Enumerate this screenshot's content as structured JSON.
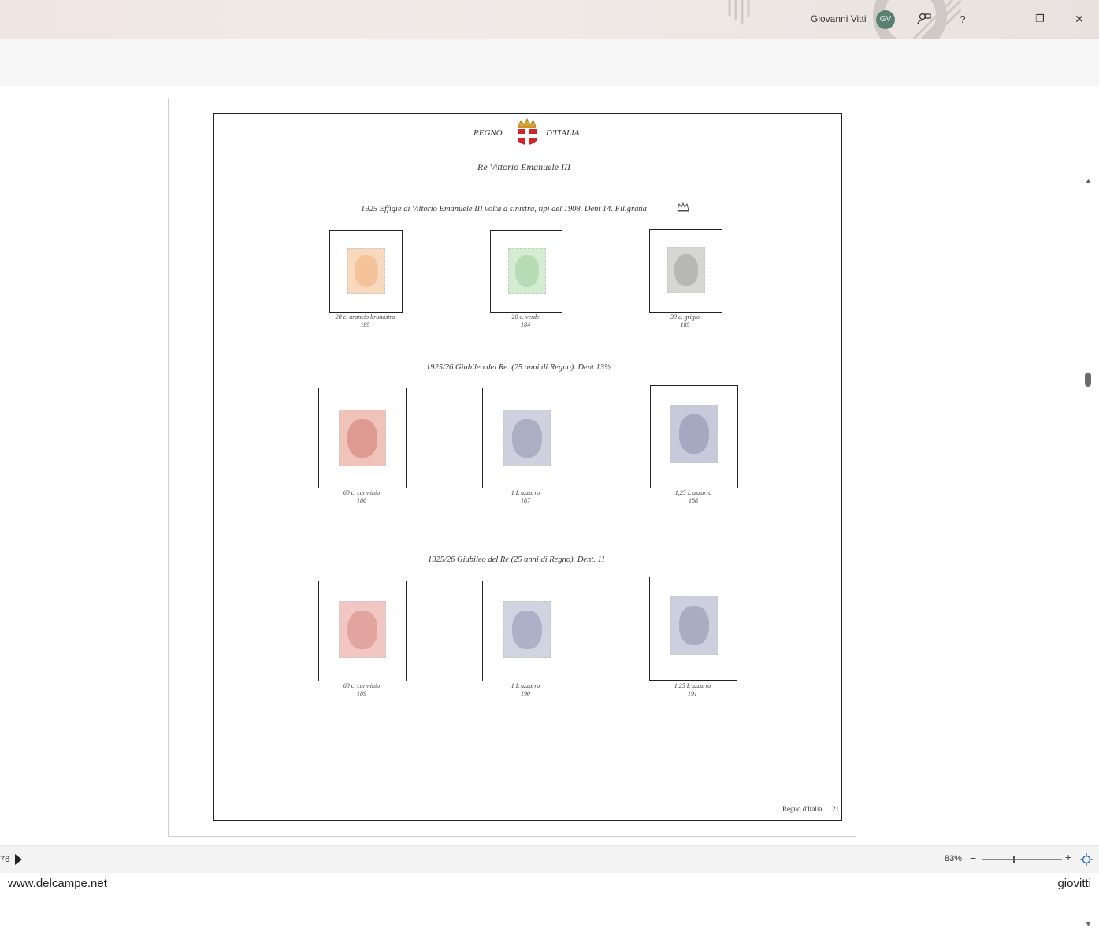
{
  "titlebar": {
    "user_name": "Giovanni Vitti",
    "avatar_initials": "GV",
    "help_label": "?",
    "minimize_label": "–",
    "restore_label": "❐",
    "close_label": "✕"
  },
  "album_page": {
    "header_left": "REGNO",
    "header_right": "D'ITALIA",
    "subtitle": "Re Vittorio Emanuele III",
    "footer_label": "Regno d'Italia",
    "page_number": "21",
    "sections": [
      {
        "heading": "1925 Effigie di Vittorio Emanuele III volta a sinistra, tipi del 1908.  Dent 14. Filigrana",
        "stamps": [
          {
            "desc": "20 c. arancio brunastro",
            "num": "185",
            "color": "#f4c49c"
          },
          {
            "desc": "20 c. verde",
            "num": "184",
            "color": "#b7dcb6"
          },
          {
            "desc": "30 c. grigio",
            "num": "185",
            "color": "#bcbdb8"
          }
        ]
      },
      {
        "heading": "1925/26 Giubileo del Re. (25 anni di Regno). Dent 13½.",
        "stamps": [
          {
            "desc": "60 c. carminio",
            "num": "186",
            "color": "#e29b8f"
          },
          {
            "desc": "1 L azzurro",
            "num": "187",
            "color": "#a9aec4"
          },
          {
            "desc": "1,25 L azzurro",
            "num": "188",
            "color": "#9ea4c0"
          }
        ]
      },
      {
        "heading": "1925/26 Giubileo del Re (25 anni di Regno). Dent. 11",
        "stamps": [
          {
            "desc": "60 c. carminio",
            "num": "189",
            "color": "#e7a09a"
          },
          {
            "desc": "1 L azzurro",
            "num": "190",
            "color": "#aab0c7"
          },
          {
            "desc": "1,25 L azzurro",
            "num": "191",
            "color": "#a3a9c2"
          }
        ]
      }
    ]
  },
  "statusbar": {
    "page_indicator": "78",
    "zoom_percent": "83%",
    "zoom_minus": "−",
    "zoom_plus": "+"
  },
  "watermark": {
    "left": "www.delcampe.net",
    "right": "giovitti"
  }
}
